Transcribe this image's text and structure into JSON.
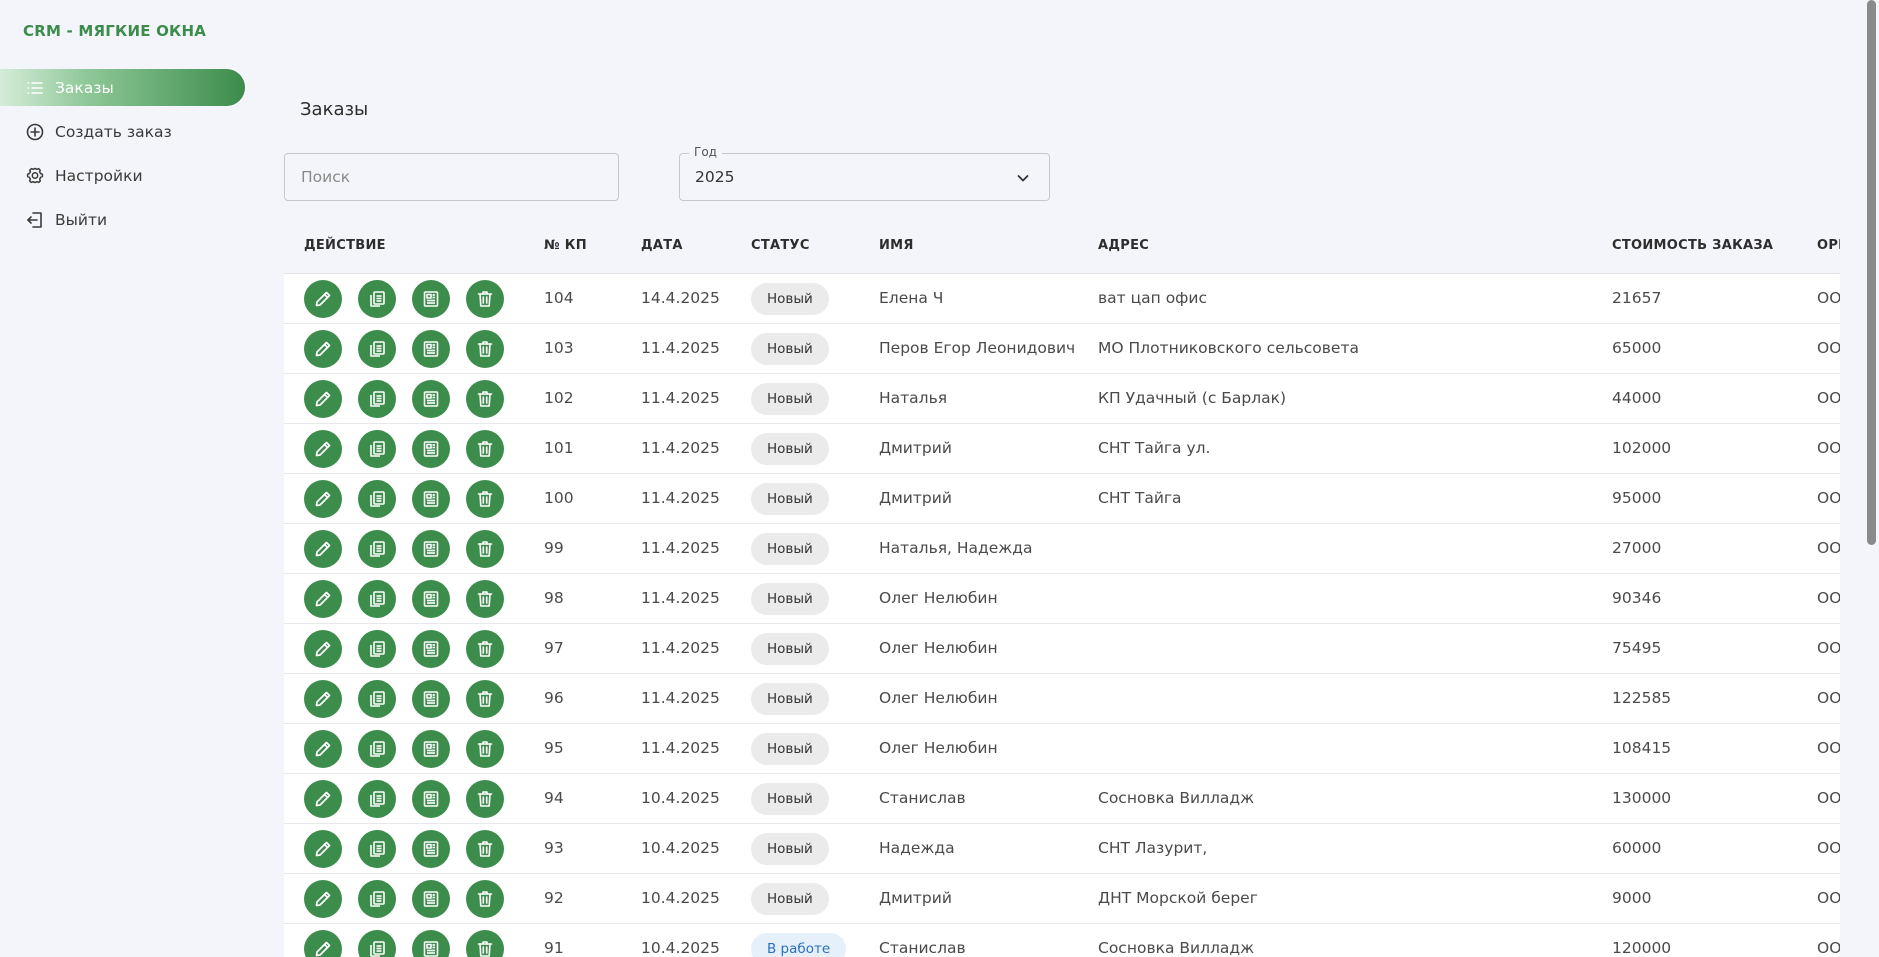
{
  "app": {
    "brand": "CRM - МЯГКИЕ ОКНА"
  },
  "sidebar": {
    "items": [
      {
        "label": "Заказы",
        "icon": "list-icon",
        "active": true
      },
      {
        "label": "Создать заказ",
        "icon": "plus-circle-icon"
      },
      {
        "label": "Настройки",
        "icon": "gear-icon"
      },
      {
        "label": "Выйти",
        "icon": "logout-icon"
      }
    ]
  },
  "main": {
    "title": "Заказы",
    "search": {
      "placeholder": "Поиск",
      "value": ""
    },
    "year": {
      "label": "Год",
      "value": "2025"
    }
  },
  "table": {
    "headers": {
      "action": "ДЕЙСТВИЕ",
      "kp": "№ КП",
      "date": "ДАТА",
      "status": "СТАТУС",
      "name": "ИМЯ",
      "address": "АДРЕС",
      "cost": "СТОИМОСТЬ ЗАКАЗА",
      "org": "ОРГ"
    },
    "rows": [
      {
        "kp": "104",
        "date": "14.4.2025",
        "status": "Новый",
        "name": "Елена Ч",
        "address": "ват цап офис",
        "cost": "21657",
        "org": "ОО"
      },
      {
        "kp": "103",
        "date": "11.4.2025",
        "status": "Новый",
        "name": "Перов Егор Леонидович",
        "address": "МО Плотниковского сельсовета",
        "cost": "65000",
        "org": "ОО"
      },
      {
        "kp": "102",
        "date": "11.4.2025",
        "status": "Новый",
        "name": "Наталья",
        "address": "КП Удачный (с Барлак)",
        "cost": "44000",
        "org": "ОО"
      },
      {
        "kp": "101",
        "date": "11.4.2025",
        "status": "Новый",
        "name": "Дмитрий",
        "address": "СНТ Тайга ул.",
        "cost": "102000",
        "org": "ОО"
      },
      {
        "kp": "100",
        "date": "11.4.2025",
        "status": "Новый",
        "name": "Дмитрий",
        "address": "СНТ Тайга",
        "cost": "95000",
        "org": "ОО"
      },
      {
        "kp": "99",
        "date": "11.4.2025",
        "status": "Новый",
        "name": "Наталья, Надежда",
        "address": "",
        "cost": "27000",
        "org": "ОО"
      },
      {
        "kp": "98",
        "date": "11.4.2025",
        "status": "Новый",
        "name": "Олег Нелюбин",
        "address": "",
        "cost": "90346",
        "org": "ОО"
      },
      {
        "kp": "97",
        "date": "11.4.2025",
        "status": "Новый",
        "name": "Олег Нелюбин",
        "address": "",
        "cost": "75495",
        "org": "ОО"
      },
      {
        "kp": "96",
        "date": "11.4.2025",
        "status": "Новый",
        "name": "Олег Нелюбин",
        "address": "",
        "cost": "122585",
        "org": "ОО"
      },
      {
        "kp": "95",
        "date": "11.4.2025",
        "status": "Новый",
        "name": "Олег Нелюбин",
        "address": "",
        "cost": "108415",
        "org": "ОО"
      },
      {
        "kp": "94",
        "date": "10.4.2025",
        "status": "Новый",
        "name": "Станислав",
        "address": "Сосновка Вилладж",
        "cost": "130000",
        "org": "ОО"
      },
      {
        "kp": "93",
        "date": "10.4.2025",
        "status": "Новый",
        "name": "Надежда",
        "address": "СНТ Лазурит,",
        "cost": "60000",
        "org": "ОО"
      },
      {
        "kp": "92",
        "date": "10.4.2025",
        "status": "Новый",
        "name": "Дмитрий",
        "address": "ДНТ Морской берег",
        "cost": "9000",
        "org": "ОО"
      },
      {
        "kp": "91",
        "date": "10.4.2025",
        "status": "В работе",
        "name": "Станислав",
        "address": "Сосновка Вилладж",
        "cost": "120000",
        "org": "ОО"
      }
    ]
  },
  "colors": {
    "accent": "#3c8c4c",
    "background": "#f4f5fa",
    "badge_new_bg": "#ebebeb",
    "badge_work_bg": "#e6f0fb",
    "badge_work_text": "#2a6fc0"
  },
  "actions": [
    "pencil-icon",
    "copy-icon",
    "document-icon",
    "trash-icon"
  ]
}
